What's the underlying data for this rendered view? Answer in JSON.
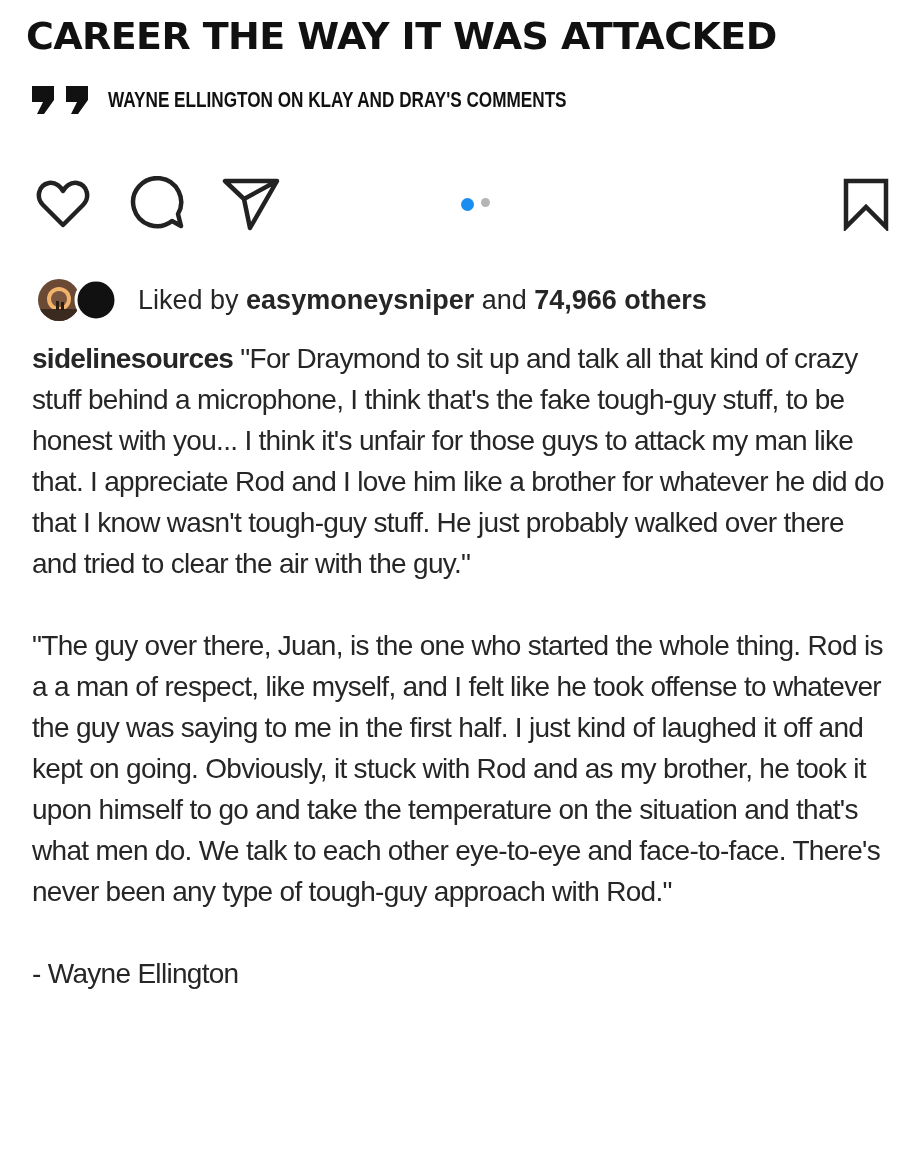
{
  "post_image": {
    "headline": "CAREER THE WAY IT WAS ATTACKED",
    "quote_caption": "WAYNE ELLINGTON ON KLAY AND DRAY'S COMMENTS"
  },
  "carousel_dots": [
    {
      "selected": true
    },
    {
      "selected": false
    }
  ],
  "likes": {
    "text": "Liked by **easymoneysniper** and **74,966 others**"
  },
  "caption": {
    "paragraphs": [
      "**sidelinesources** \"For Draymond to sit up and talk all that kind of crazy stuff behind a microphone, I think that's the fake tough-guy stuff, to be honest with you... I think it's unfair for those guys to attack my man like that. I appreciate Rod and I love him like a brother for whatever he did do that I know wasn't tough-guy stuff. He just probably walked over there and tried to clear the air with the guy.\"",
      "\"The guy over there, Juan, is the one who started the whole thing. Rod is a a man of respect, like myself, and I felt like he took offense to whatever the guy was saying to me in the first half. I just kind of laughed it off and kept on going. Obviously, it stuck with Rod and as my brother, he took it upon himself to go and take the temperature on the situation and that's what men do. We talk to each other eye-to-eye and face-to-face. There's never been any type of tough-guy approach with Rod.\"",
      "- Wayne Ellington"
    ]
  }
}
